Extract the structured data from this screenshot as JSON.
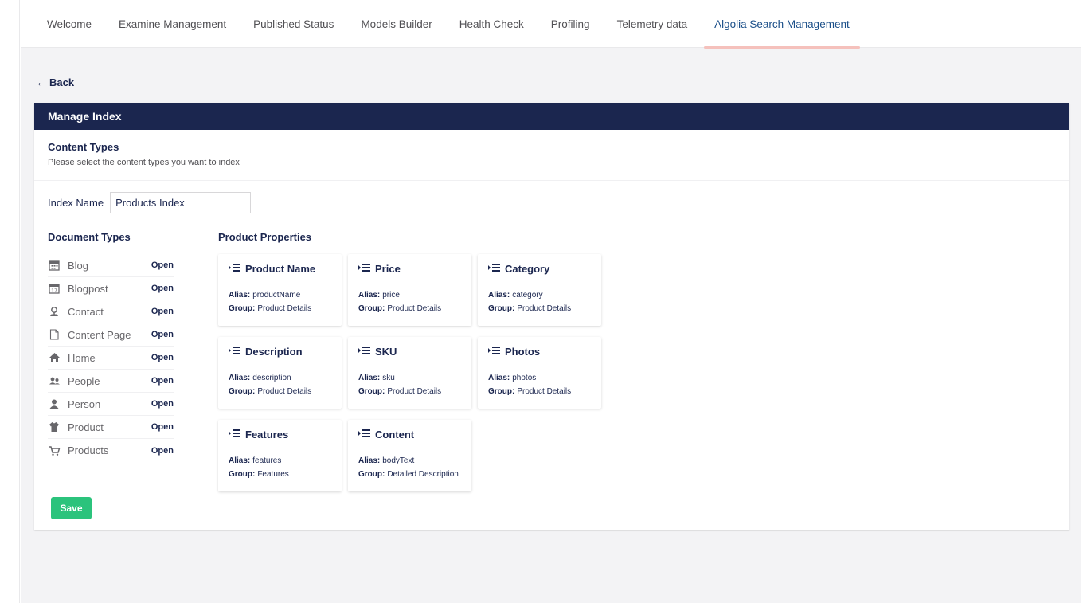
{
  "tabs": [
    {
      "label": "Welcome",
      "active": false
    },
    {
      "label": "Examine Management",
      "active": false
    },
    {
      "label": "Published Status",
      "active": false
    },
    {
      "label": "Models Builder",
      "active": false
    },
    {
      "label": "Health Check",
      "active": false
    },
    {
      "label": "Profiling",
      "active": false
    },
    {
      "label": "Telemetry data",
      "active": false
    },
    {
      "label": "Algolia Search Management",
      "active": true
    }
  ],
  "back_label": "Back",
  "panel": {
    "title": "Manage Index",
    "section_title": "Content Types",
    "section_desc": "Please select the content types you want to index",
    "index_name_label": "Index Name",
    "index_name_value": "Products Index",
    "doc_types_title": "Document Types",
    "props_title": "Product Properties",
    "save_label": "Save"
  },
  "doc_types": [
    {
      "label": "Blog",
      "action": "Open",
      "icon": "calendar-icon"
    },
    {
      "label": "Blogpost",
      "action": "Open",
      "icon": "calendar-date-icon"
    },
    {
      "label": "Contact",
      "action": "Open",
      "icon": "location-pin-icon"
    },
    {
      "label": "Content Page",
      "action": "Open",
      "icon": "document-icon"
    },
    {
      "label": "Home",
      "action": "Open",
      "icon": "home-icon"
    },
    {
      "label": "People",
      "action": "Open",
      "icon": "people-icon"
    },
    {
      "label": "Person",
      "action": "Open",
      "icon": "person-icon"
    },
    {
      "label": "Product",
      "action": "Open",
      "icon": "shirt-icon"
    },
    {
      "label": "Products",
      "action": "Open",
      "icon": "cart-icon"
    }
  ],
  "properties": [
    {
      "name": "Product Name",
      "alias_label": "Alias:",
      "alias": "productName",
      "group_label": "Group:",
      "group": "Product Details"
    },
    {
      "name": "Price",
      "alias_label": "Alias:",
      "alias": "price",
      "group_label": "Group:",
      "group": "Product Details"
    },
    {
      "name": "Category",
      "alias_label": "Alias:",
      "alias": "category",
      "group_label": "Group:",
      "group": "Product Details"
    },
    {
      "name": "Description",
      "alias_label": "Alias:",
      "alias": "description",
      "group_label": "Group:",
      "group": "Product Details"
    },
    {
      "name": "SKU",
      "alias_label": "Alias:",
      "alias": "sku",
      "group_label": "Group:",
      "group": "Product Details"
    },
    {
      "name": "Photos",
      "alias_label": "Alias:",
      "alias": "photos",
      "group_label": "Group:",
      "group": "Product Details"
    },
    {
      "name": "Features",
      "alias_label": "Alias:",
      "alias": "features",
      "group_label": "Group:",
      "group": "Features"
    },
    {
      "name": "Content",
      "alias_label": "Alias:",
      "alias": "bodyText",
      "group_label": "Group:",
      "group": "Detailed Description"
    }
  ],
  "colors": {
    "header_navy": "#1b264f",
    "save_green": "#2bc37c",
    "active_tab_text": "#1b4f89",
    "active_tab_underline": "#f5c1bc"
  }
}
